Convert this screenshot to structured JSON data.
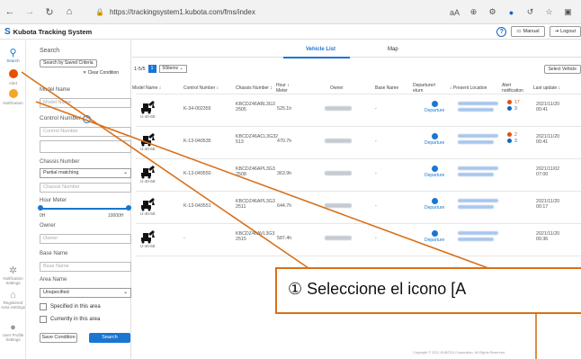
{
  "browser": {
    "url": "https://trackingsystem1.kubota.com/fms/index",
    "reader_label": "aA"
  },
  "header": {
    "title": "Kubota Tracking System",
    "help_icon": "question-circle-icon",
    "manual_label": "Manual",
    "logout_label": "Logout"
  },
  "rail": {
    "items": [
      {
        "label": "Search",
        "icon": "search-icon"
      },
      {
        "label": "Alert",
        "icon": "alert-icon"
      },
      {
        "label": "Notification",
        "icon": "notification-icon"
      },
      {
        "label": "Notification Settings",
        "icon": "gear-icon"
      },
      {
        "label": "Registered Area Settings",
        "icon": "area-icon"
      },
      {
        "label": "User Profile Settings",
        "icon": "user-icon"
      }
    ]
  },
  "filter": {
    "title": "Search",
    "saved_criteria": "Search by Saved Criteria",
    "clear_condition": "Clear Condition",
    "model_name_label": "Model Name",
    "model_name_placeholder": "Model Name",
    "control_number_label": "Control Number",
    "control_number_placeholder": "Control Number",
    "chassis_label": "Chassis Number",
    "chassis_match": "Partial matching",
    "chassis_placeholder": "Chassis Number",
    "hour_meter_label": "Hour Meter",
    "hour_min": "0H",
    "hour_max": "10000H",
    "owner_label": "Owner",
    "owner_placeholder": "Owner",
    "base_name_label": "Base Name",
    "base_name_placeholder": "Base Name",
    "area_name_label": "Area Name",
    "area_value": "Unspecified",
    "specified_label": "Specified in this area",
    "currently_label": "Currently in this area",
    "save_label": "Save Condition",
    "search_label": "Search"
  },
  "main": {
    "tab_vehicle": "Vehicle List",
    "tab_map": "Map",
    "range": "1-5/5",
    "page": "1",
    "per_page": "50items",
    "select_vehicle": "Select Vehicle",
    "columns": {
      "model": "Model Name",
      "control": "Control Number",
      "chassis": "Chassis Number",
      "hour_a": "Hour",
      "hour_b": "Meter",
      "owner": "Owner",
      "base": "Base Name",
      "dep_a": "Departure/r",
      "dep_b": "eturn",
      "present": "Present Location",
      "alert_a": "Alert",
      "alert_b": "notification",
      "update": "Last update"
    },
    "rows": [
      {
        "model": "U-40-6E",
        "control": "K-34-002355",
        "chassis_a": "KBCDZ46ABL3G3",
        "chassis_b": "2505",
        "hour": "525.1h",
        "base": "-",
        "dep": "Departure",
        "alert_o": "17",
        "alert_b": "3",
        "date": "2021/11/20",
        "time": "00:41"
      },
      {
        "model": "U-40-6E",
        "control": "K-13-040535",
        "chassis_a": "KBCDZ46ACL3G32",
        "chassis_b": "513",
        "hour": "470.7h",
        "base": "-",
        "dep": "Departure",
        "alert_o": "2",
        "alert_b": "3",
        "date": "2021/11/20",
        "time": "00:41"
      },
      {
        "model": "U-40-6E",
        "control": "K-13-040550",
        "chassis_a": "KBCDZ46APL3G3",
        "chassis_b": "2508",
        "hour": "363.9h",
        "base": "-",
        "dep": "Departure",
        "alert_o": "",
        "alert_b": "",
        "date": "2021/11/02",
        "time": "07:00"
      },
      {
        "model": "U-40-6E",
        "control": "K-13-040551",
        "chassis_a": "KBCDZ46APL3G3",
        "chassis_b": "2511",
        "hour": "644.7h",
        "base": "-",
        "dep": "Departure",
        "alert_o": "",
        "alert_b": "",
        "date": "2021/11/20",
        "time": "00:17"
      },
      {
        "model": "U-40-6E",
        "control": "-",
        "chassis_a": "KBCDZ46AVL3G3",
        "chassis_b": "2515",
        "hour": "587.4h",
        "base": "-",
        "dep": "Departure",
        "alert_o": "",
        "alert_b": "",
        "date": "2021/11/20",
        "time": "00:36"
      }
    ],
    "footer": "Copyright © 2021 KUBOTA Corporation. All Rights Reserved."
  },
  "annotation": {
    "text": "① Seleccione el icono [A",
    "color": "#d87018"
  }
}
